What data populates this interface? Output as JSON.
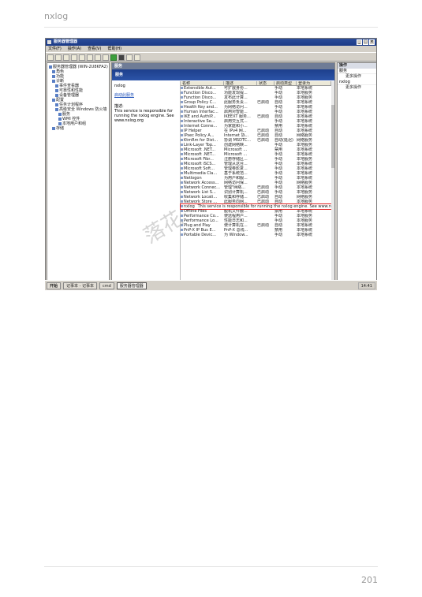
{
  "page": {
    "header": "nxlog",
    "page_number": "201"
  },
  "window": {
    "title": "服务器管理器",
    "controls": [
      "_",
      "□",
      "×"
    ]
  },
  "menu": [
    "文件(F)",
    "操作(A)",
    "查看(V)",
    "帮助(H)"
  ],
  "tree": [
    {
      "label": "服务器管理器 (WIN-2U8KFA2)",
      "indent": 0
    },
    {
      "label": "角色",
      "indent": 1
    },
    {
      "label": "功能",
      "indent": 1
    },
    {
      "label": "诊断",
      "indent": 1
    },
    {
      "label": "事件查看器",
      "indent": 2
    },
    {
      "label": "可靠性和性能",
      "indent": 2
    },
    {
      "label": "设备管理器",
      "indent": 2
    },
    {
      "label": "配置",
      "indent": 1
    },
    {
      "label": "任务计划程序",
      "indent": 2
    },
    {
      "label": "高级安全 Windows 防火墙",
      "indent": 2
    },
    {
      "label": "服务",
      "indent": 3
    },
    {
      "label": "WMI 控件",
      "indent": 3
    },
    {
      "label": "本地用户和组",
      "indent": 3
    },
    {
      "label": "存储",
      "indent": 1
    }
  ],
  "center": {
    "header": "服务",
    "band": "服务",
    "service_name": "nxlog",
    "link": "启动此服务",
    "desc_label": "描述:",
    "desc_text": "This service is responsible for running the nxlog engine. See www.nxlog.org"
  },
  "columns": [
    "名称",
    "描述",
    "状态",
    "启动类型",
    "登录为"
  ],
  "services": [
    {
      "name": "Extensible Aut...",
      "desc": "可扩展身份...",
      "status": "",
      "start": "手动",
      "logon": "本地系统"
    },
    {
      "name": "Function Disco...",
      "desc": "功能发现提...",
      "status": "",
      "start": "手动",
      "logon": "本地服务"
    },
    {
      "name": "Function Disco...",
      "desc": "发布此计算...",
      "status": "",
      "start": "手动",
      "logon": "本地服务"
    },
    {
      "name": "Group Policy C...",
      "desc": "此服务负责...",
      "status": "已启动",
      "start": "自动",
      "logon": "本地系统"
    },
    {
      "name": "Health Key and...",
      "desc": "为网络访问...",
      "status": "",
      "start": "手动",
      "logon": "本地系统"
    },
    {
      "name": "Human Interfac...",
      "desc": "启用对智能...",
      "status": "",
      "start": "手动",
      "logon": "本地系统"
    },
    {
      "name": "IKE and AuthIP...",
      "desc": "IKEEXT 服务...",
      "status": "已启动",
      "start": "自动",
      "logon": "本地系统"
    },
    {
      "name": "Interactive Se...",
      "desc": "启用交互式...",
      "status": "",
      "start": "手动",
      "logon": "本地系统"
    },
    {
      "name": "Internet Conne...",
      "desc": "为家庭和小...",
      "status": "",
      "start": "禁用",
      "logon": "本地系统"
    },
    {
      "name": "IP Helper",
      "desc": "在 IPv4 网...",
      "status": "已启动",
      "start": "自动",
      "logon": "本地系统"
    },
    {
      "name": "IPsec Policy A...",
      "desc": "Internet 协...",
      "status": "已启动",
      "start": "自动",
      "logon": "网络服务"
    },
    {
      "name": "KtmRm for Dist...",
      "desc": "协调 MSDTC...",
      "status": "已启动",
      "start": "自动(延迟)",
      "logon": "网络服务"
    },
    {
      "name": "Link-Layer Top...",
      "desc": "创建网络映...",
      "status": "",
      "start": "手动",
      "logon": "本地服务"
    },
    {
      "name": "Microsoft .NET...",
      "desc": "Microsoft ...",
      "status": "",
      "start": "禁用",
      "logon": "本地系统"
    },
    {
      "name": "Microsoft .NET...",
      "desc": "Microsoft ...",
      "status": "",
      "start": "手动",
      "logon": "本地系统"
    },
    {
      "name": "Microsoft Fibr...",
      "desc": "注册存储区...",
      "status": "",
      "start": "手动",
      "logon": "本地服务"
    },
    {
      "name": "Microsoft iSCS...",
      "desc": "管理从这台...",
      "status": "",
      "start": "手动",
      "logon": "本地系统"
    },
    {
      "name": "Microsoft Soft...",
      "desc": "管理卷影复...",
      "status": "",
      "start": "手动",
      "logon": "本地系统"
    },
    {
      "name": "Multimedia Cla...",
      "desc": "基于系统范...",
      "status": "",
      "start": "手动",
      "logon": "本地系统"
    },
    {
      "name": "Netlogon",
      "desc": "为用户和服...",
      "status": "",
      "start": "手动",
      "logon": "本地系统"
    },
    {
      "name": "Network Access...",
      "desc": "网络访问保...",
      "status": "",
      "start": "手动",
      "logon": "网络服务"
    },
    {
      "name": "Network Connec...",
      "desc": "管理\"网络...",
      "status": "已启动",
      "start": "手动",
      "logon": "本地系统"
    },
    {
      "name": "Network List S...",
      "desc": "识别计算机...",
      "status": "已启动",
      "start": "手动",
      "logon": "本地服务"
    },
    {
      "name": "Network Locati...",
      "desc": "收集和存储...",
      "status": "已启动",
      "start": "自动",
      "logon": "网络服务"
    },
    {
      "name": "Network Store ...",
      "desc": "此服务向网...",
      "status": "已启动",
      "start": "自动",
      "logon": "本地服务"
    },
    {
      "name": "nxlog",
      "desc": "This service is responsible for running the nxlog engine. See www.nxlog.org",
      "status": "",
      "start": "",
      "logon": "",
      "selected": true
    },
    {
      "name": "Offline Files",
      "desc": "脱机文件服...",
      "status": "",
      "start": "禁用",
      "logon": "本地系统"
    },
    {
      "name": "Performance Co...",
      "desc": "使远程用户...",
      "status": "",
      "start": "手动",
      "logon": "本地服务"
    },
    {
      "name": "Performance Lo...",
      "desc": "性能日志和...",
      "status": "",
      "start": "手动",
      "logon": "本地服务"
    },
    {
      "name": "Plug and Play",
      "desc": "使计算机在...",
      "status": "已启动",
      "start": "自动",
      "logon": "本地系统"
    },
    {
      "name": "PnP-X IP Bus E...",
      "desc": "PnP-X 总线...",
      "status": "",
      "start": "禁用",
      "logon": "本地系统"
    },
    {
      "name": "Portable Devic...",
      "desc": "为 Window...",
      "status": "",
      "start": "手动",
      "logon": "本地系统"
    }
  ],
  "tabs": [
    "扩展",
    "标准"
  ],
  "actions": {
    "head": "操作",
    "group1": "服务",
    "more1": "更多操作",
    "group2": "nxlog",
    "more2": "更多操作"
  },
  "taskbar": {
    "start": "开始",
    "items": [
      "记事本 - 记事本",
      "cmd",
      "服务器管理器"
    ],
    "clock": "14:41"
  },
  "watermark": "落花"
}
